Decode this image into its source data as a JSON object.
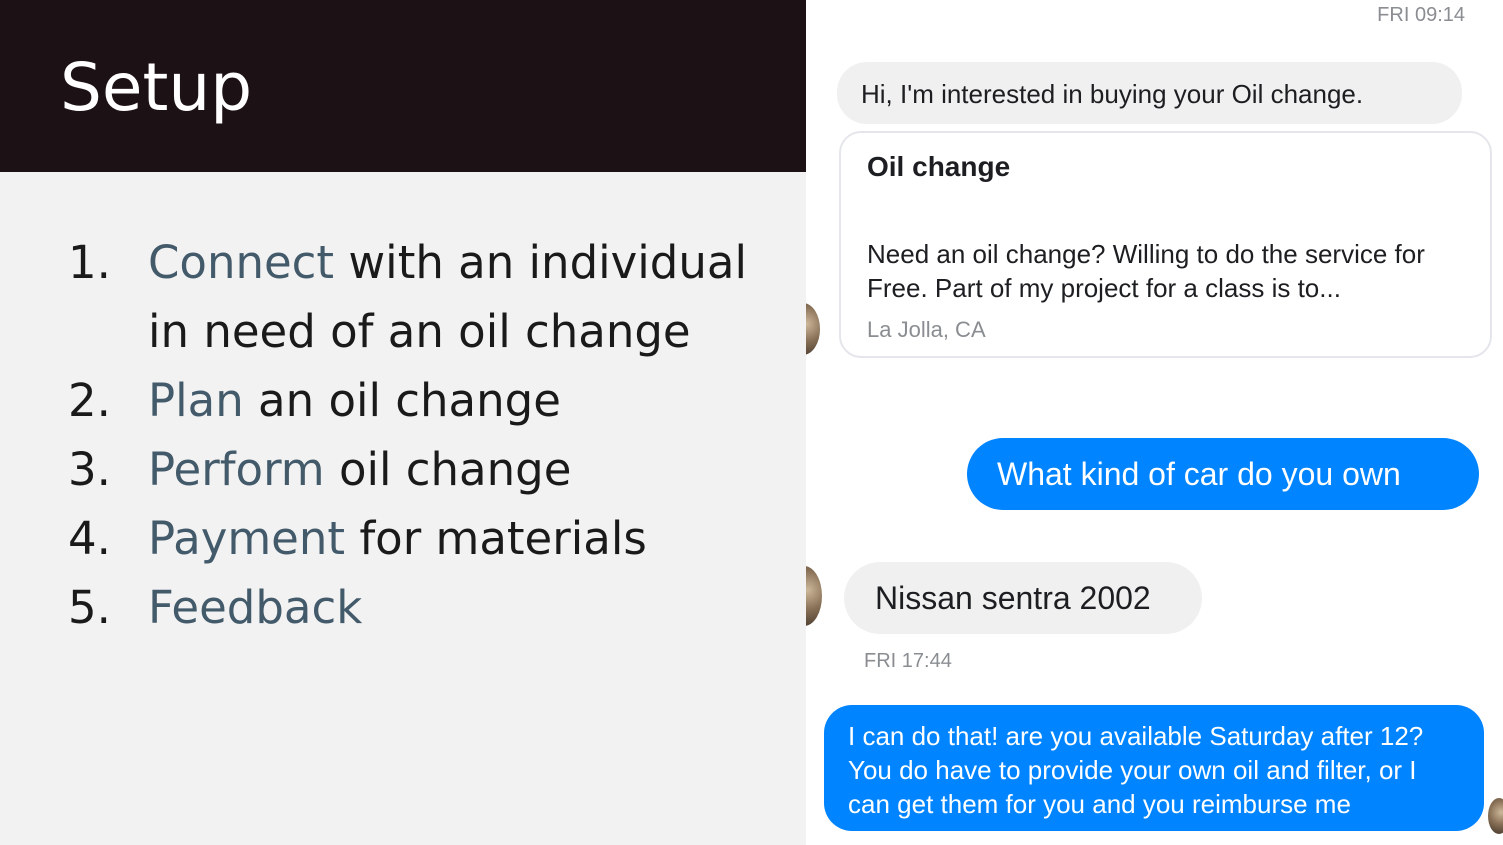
{
  "slide": {
    "title": "Setup",
    "steps": [
      {
        "num": "1.",
        "highlight": "Connect",
        "rest": " with an individual in need of an oil change"
      },
      {
        "num": "2.",
        "highlight": "Plan",
        "rest": " an oil change"
      },
      {
        "num": "3.",
        "highlight": "Perform",
        "rest": " oil change"
      },
      {
        "num": "4.",
        "highlight": "Payment",
        "rest": " for materials"
      },
      {
        "num": "5.",
        "highlight": "Feedback",
        "rest": ""
      }
    ]
  },
  "chat": {
    "timestamp_top": "FRI 09:14",
    "msg1": "Hi, I'm interested in buying your Oil change.",
    "card": {
      "title": "Oil change",
      "description": "Need an oil change? Willing to do the service for Free. Part of my project for a class is to...",
      "location": "La Jolla, CA"
    },
    "msg2": "What kind of car do you own",
    "msg3": "Nissan sentra 2002",
    "timestamp_mid": "FRI 17:44",
    "msg4": "I can do that! are you available Saturday after 12? You do have to provide your own oil and filter, or I can get them for you and you reimburse me"
  },
  "colors": {
    "header_bg": "#1c1115",
    "highlight": "#435a6b",
    "outgoing_bubble": "#0084ff",
    "incoming_bubble": "#f0f0f0"
  }
}
